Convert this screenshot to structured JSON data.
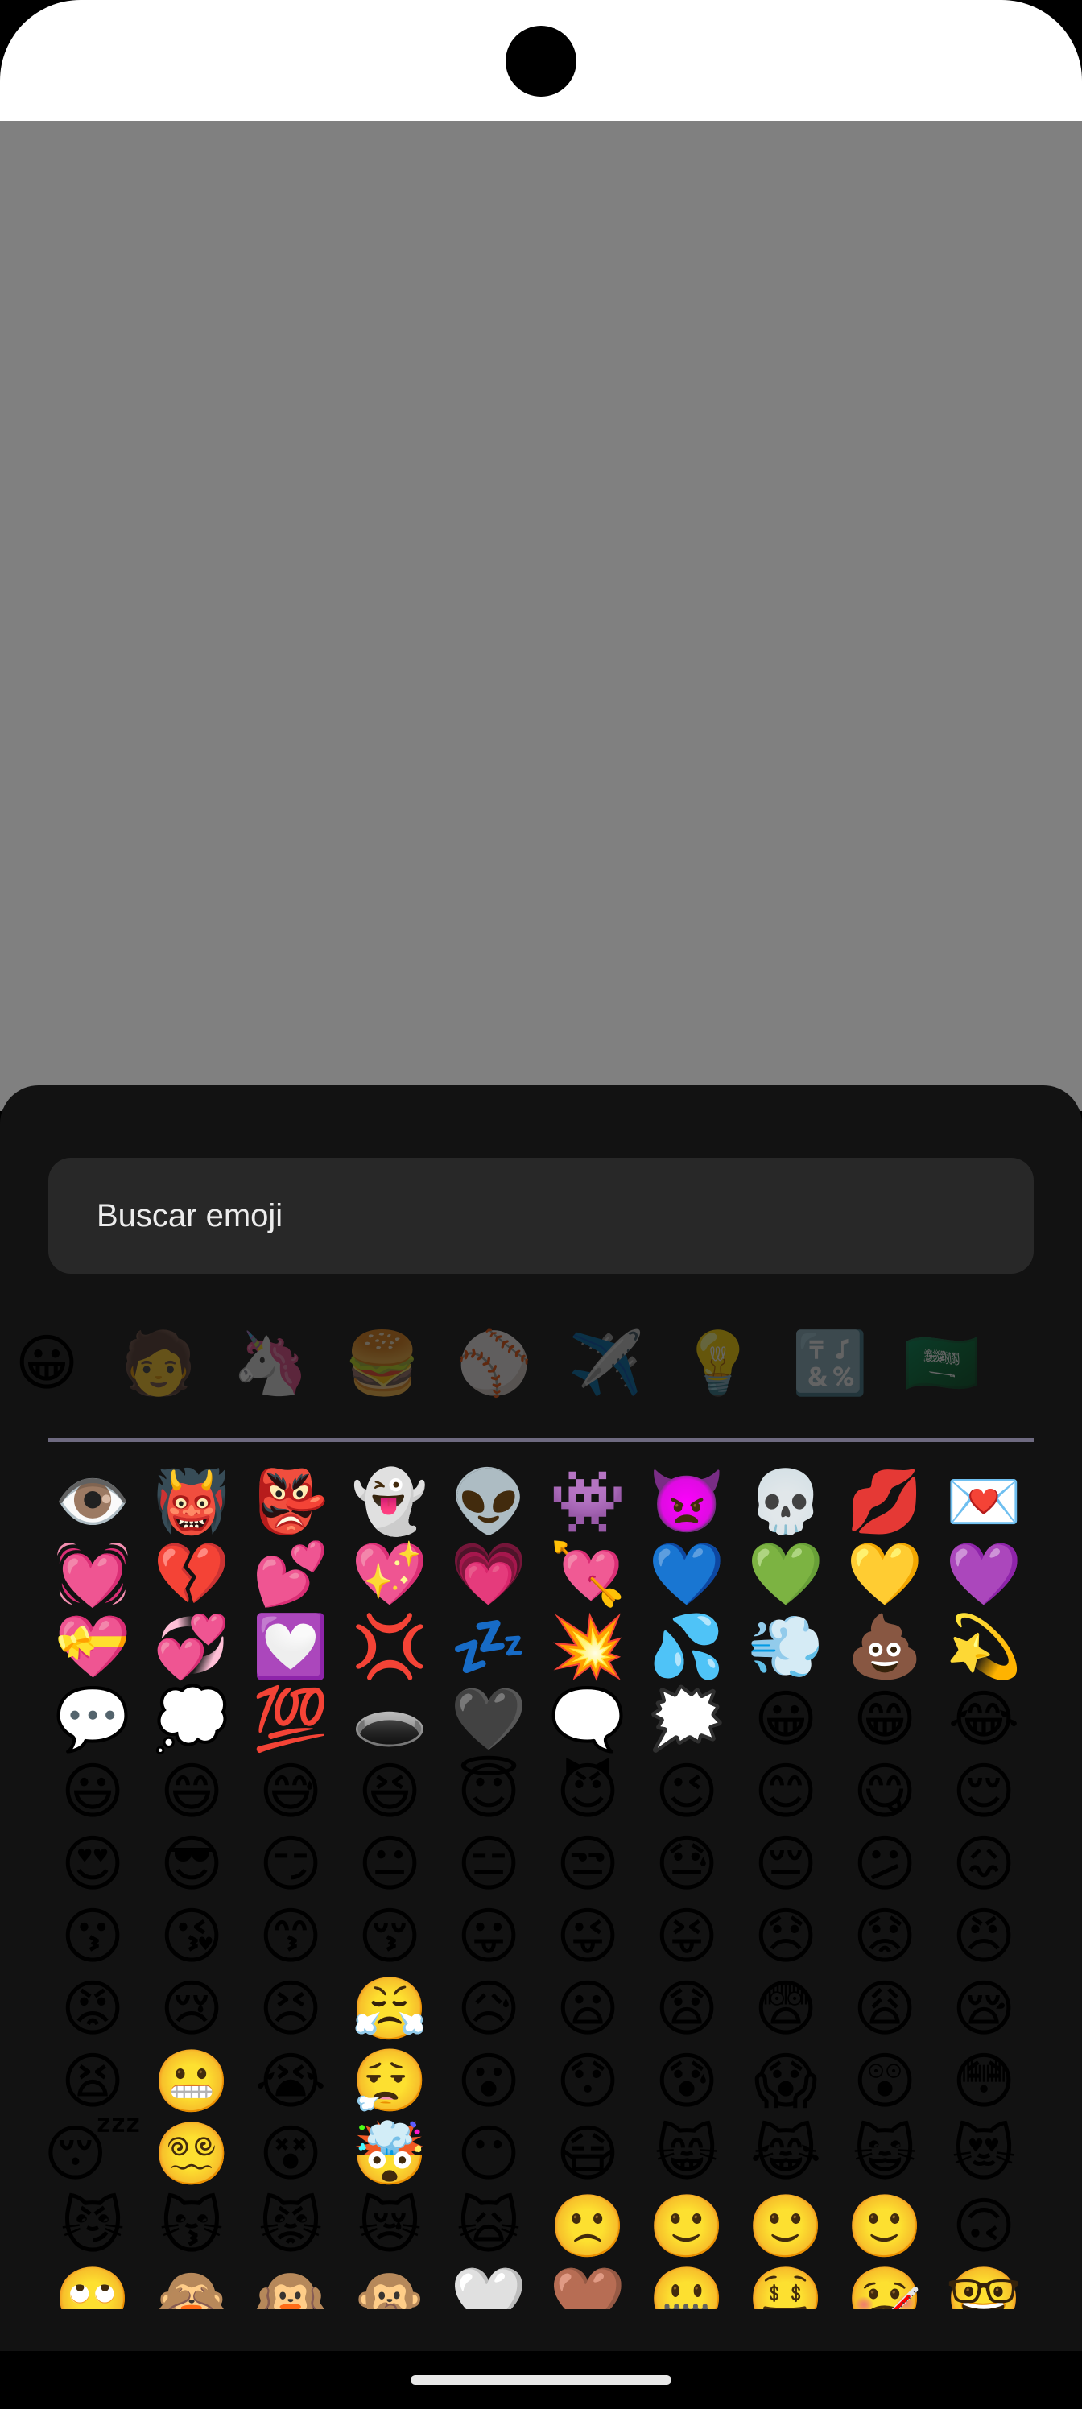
{
  "search": {
    "placeholder": "Buscar emoji"
  },
  "categories": [
    {
      "name": "smileys",
      "glyph": "😀",
      "active": true
    },
    {
      "name": "people",
      "glyph": "🧑",
      "active": false
    },
    {
      "name": "animals",
      "glyph": "🦄",
      "active": false
    },
    {
      "name": "food",
      "glyph": "🍔",
      "active": false
    },
    {
      "name": "activities",
      "glyph": "⚾",
      "active": false
    },
    {
      "name": "travel",
      "glyph": "✈️",
      "active": false
    },
    {
      "name": "objects",
      "glyph": "💡",
      "active": false
    },
    {
      "name": "symbols",
      "glyph": "🔣",
      "active": false
    },
    {
      "name": "flags",
      "glyph": "🇸🇦",
      "active": false
    }
  ],
  "emoji_rows": [
    [
      "👁️",
      "👹",
      "👺",
      "👻",
      "👽",
      "👾",
      "👿",
      "💀",
      "💋",
      "💌"
    ],
    [
      "💓",
      "💔",
      "💕",
      "💖",
      "💗",
      "💘",
      "💙",
      "💚",
      "💛",
      "💜"
    ],
    [
      "💝",
      "💞",
      "💟",
      "💢",
      "💤",
      "💥",
      "💦",
      "💨",
      "💩",
      "💫"
    ],
    [
      "💬",
      "💭",
      "💯",
      "🕳️",
      "🖤",
      "🗨️",
      "🗯️",
      "😀",
      "😁",
      "😂"
    ],
    [
      "😃",
      "😄",
      "😅",
      "😆",
      "😇",
      "😈",
      "😉",
      "😊",
      "😋",
      "😌"
    ],
    [
      "😍",
      "😎",
      "😏",
      "😐",
      "😑",
      "😒",
      "😓",
      "😔",
      "😕",
      "😖"
    ],
    [
      "😗",
      "😘",
      "😙",
      "😚",
      "😛",
      "😜",
      "😝",
      "😞",
      "😟",
      "😠"
    ],
    [
      "😡",
      "😢",
      "😣",
      "😤",
      "😥",
      "😦",
      "😧",
      "😨",
      "😩",
      "😪"
    ],
    [
      "😫",
      "😬",
      "😭",
      "😮‍💨",
      "😮",
      "😯",
      "😰",
      "😱",
      "😲",
      "😳"
    ],
    [
      "😴",
      "😵‍💫",
      "😵",
      "🤯",
      "😶",
      "😷",
      "😸",
      "😹",
      "😺",
      "😻"
    ],
    [
      "😼",
      "😽",
      "😾",
      "😿",
      "🙀",
      "🙁",
      "🙂",
      "🙂",
      "🙂",
      "🙃"
    ],
    [
      "🙄",
      "🙈",
      "🙉",
      "🙊",
      "🤍",
      "🤎",
      "🤐",
      "🤑",
      "🤒",
      "🤓"
    ]
  ]
}
